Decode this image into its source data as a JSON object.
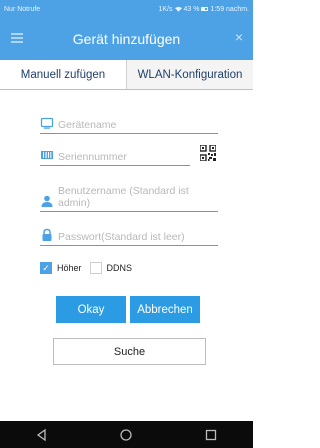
{
  "status_bar": {
    "carrier": "Nur Notrufe",
    "indicators": "1K/s",
    "battery": "43 %",
    "time": "1:59 nachm."
  },
  "header": {
    "title": "Gerät hinzufügen",
    "close_label": "×"
  },
  "tabs": [
    {
      "label": "Manuell zufügen"
    },
    {
      "label": "WLAN-Konfiguration"
    }
  ],
  "form": {
    "device_name": {
      "placeholder": "Gerätename",
      "value": ""
    },
    "serial_number": {
      "placeholder": "Seriennummer",
      "value": ""
    },
    "username": {
      "placeholder": "Benutzername (Standard ist admin)",
      "value": ""
    },
    "password": {
      "placeholder": "Passwort(Standard ist leer)",
      "value": ""
    }
  },
  "options": {
    "hoeher": {
      "label": "Höher",
      "checked": true,
      "check_mark": "✓"
    },
    "ddns": {
      "label": "DDNS",
      "checked": false
    }
  },
  "buttons": {
    "okay": "Okay",
    "cancel": "Abbrechen",
    "search": "Suche"
  },
  "icons": {
    "device": "monitor-icon",
    "serial": "barcode-icon",
    "user": "user-icon",
    "password": "lock-icon",
    "qr": "qr-code-icon"
  },
  "colors": {
    "accent": "#4da2e6",
    "button": "#2b9be4",
    "tab_text": "#1f3f6b"
  }
}
